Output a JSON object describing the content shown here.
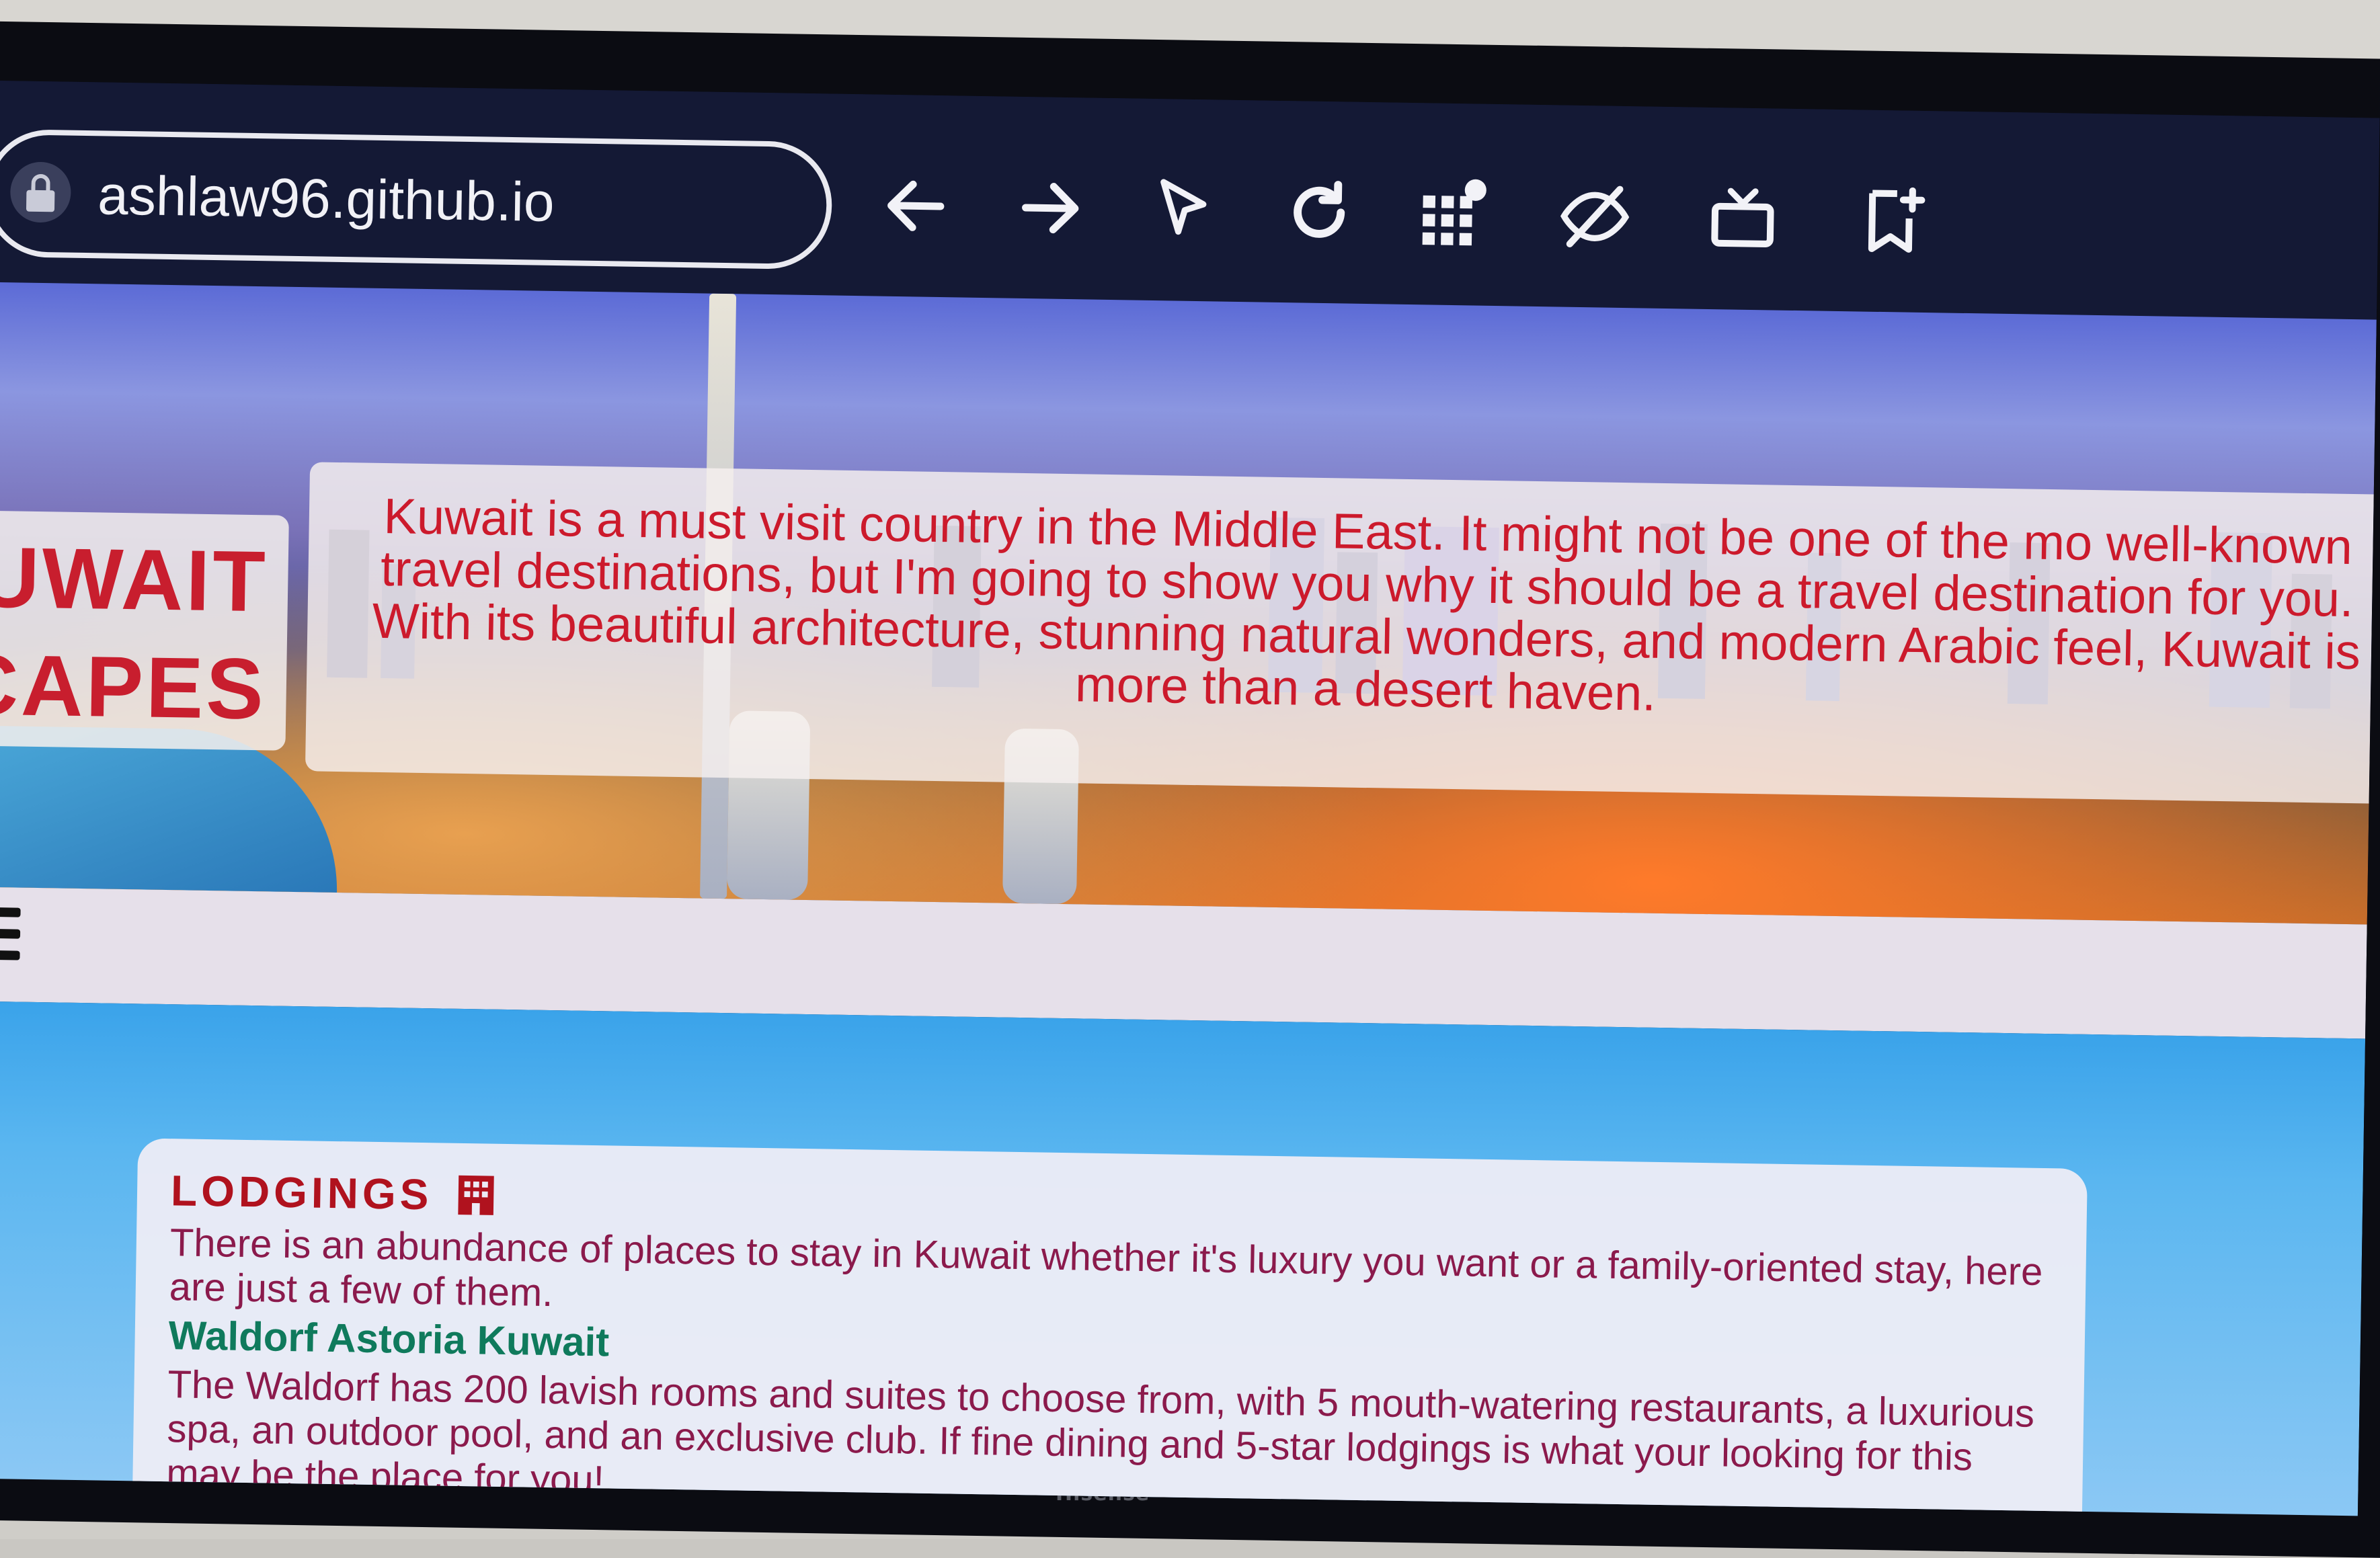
{
  "browser": {
    "url": "ashlaw96.github.io",
    "buttons": {
      "back": "back",
      "forward": "forward",
      "pointer": "pointer",
      "reload": "reload",
      "apps": "apps",
      "hide": "hide",
      "tv": "tv",
      "bookmark": "bookmark"
    }
  },
  "hero": {
    "logo_line1": "UWAIT",
    "logo_line2": "CAPES",
    "intro": "Kuwait is a must visit country in the Middle East. It might not be one of the mo well-known travel destinations, but I'm going to show you why it should be a travel destination for you. With its beautiful architecture, stunning natural wonders, and modern Arabic feel, Kuwait is more than a desert haven."
  },
  "lodgings": {
    "title": "LODGINGS",
    "intro": "There is an abundance of places to stay in Kuwait whether it's luxury you want or a family-oriented stay, here are just a few of them.",
    "hotels": [
      {
        "name": "Waldorf Astoria Kuwait",
        "description": "The Waldorf has 200 lavish rooms and suites to choose from, with 5 mouth-watering restaurants, a luxurious spa, an outdoor pool, and an exclusive club. If fine dining and 5-star lodgings is what your looking for this may be the place for you!"
      }
    ]
  },
  "tv": {
    "brand": "Hisense"
  },
  "colors": {
    "accent_red": "#cc1a2c",
    "hotel_green": "#0f7a5c",
    "toolbar_bg": "#141935"
  }
}
